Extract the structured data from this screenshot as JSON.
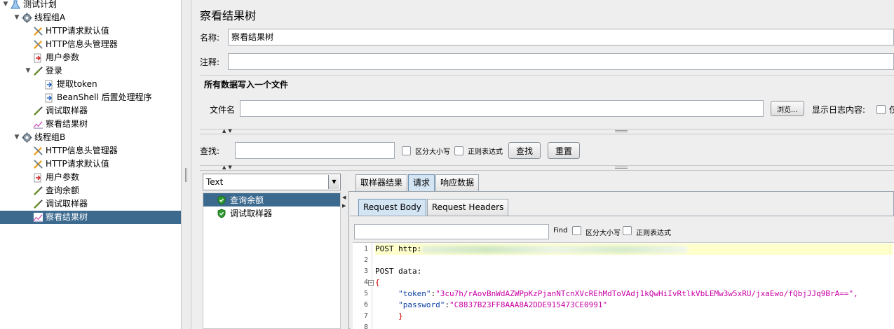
{
  "tree": {
    "items": [
      {
        "label": "测试计划",
        "icon": "test-plan-icon",
        "twist": "▼",
        "level": 0
      },
      {
        "label": "线程组A",
        "icon": "gear-icon",
        "twist": "▼",
        "level": 1
      },
      {
        "label": "HTTP请求默认值",
        "icon": "wrench-icon",
        "twist": "",
        "level": 2
      },
      {
        "label": "HTTP信息头管理器",
        "icon": "wrench-icon",
        "twist": "",
        "level": 2
      },
      {
        "label": "用户参数",
        "icon": "preprocessor-icon",
        "twist": "",
        "level": 2
      },
      {
        "label": "登录",
        "icon": "pipette-icon",
        "twist": "▼",
        "level": 2
      },
      {
        "label": "提取token",
        "icon": "postprocessor-icon",
        "twist": "",
        "level": 3
      },
      {
        "label": "BeanShell 后置处理程序",
        "icon": "postprocessor-icon",
        "twist": "",
        "level": 3
      },
      {
        "label": "调试取样器",
        "icon": "pipette-icon",
        "twist": "",
        "level": 2
      },
      {
        "label": "察看结果树",
        "icon": "listener-icon",
        "twist": "",
        "level": 2
      },
      {
        "label": "线程组B",
        "icon": "gear-icon",
        "twist": "▼",
        "level": 1
      },
      {
        "label": "HTTP信息头管理器",
        "icon": "wrench-icon",
        "twist": "",
        "level": 2
      },
      {
        "label": "HTTP请求默认值",
        "icon": "wrench-icon",
        "twist": "",
        "level": 2
      },
      {
        "label": "用户参数",
        "icon": "preprocessor-icon",
        "twist": "",
        "level": 2
      },
      {
        "label": "查询余额",
        "icon": "pipette-icon",
        "twist": "",
        "level": 2
      },
      {
        "label": "调试取样器",
        "icon": "pipette-icon",
        "twist": "",
        "level": 2
      },
      {
        "label": "察看结果树",
        "icon": "listener-icon",
        "twist": "",
        "level": 2,
        "selected": true
      }
    ]
  },
  "panel": {
    "title": "察看结果树",
    "name_label": "名称:",
    "name_value": "察看结果树",
    "comment_label": "注释:",
    "comment_value": "",
    "file_group_title": "所有数据写入一个文件",
    "filename_label": "文件名",
    "filename_value": "",
    "browse_button": "浏览...",
    "log_display_label": "显示日志内容:",
    "log_display_option": "仅",
    "search_label": "查找:",
    "search_value": "",
    "case_sensitive": "区分大小写",
    "regex": "正则表达式",
    "find_button": "查找",
    "reset_button": "重置"
  },
  "results": {
    "renderer": "Text",
    "samples": [
      {
        "label": "查询余额",
        "selected": true
      },
      {
        "label": "调试取样器",
        "selected": false
      }
    ]
  },
  "detail": {
    "tabs": [
      "取样器结果",
      "请求",
      "响应数据"
    ],
    "active_tab": "请求",
    "subtabs": [
      "Request Body",
      "Request Headers"
    ],
    "active_subtab": "Request Body",
    "find_label": "Find",
    "case_sensitive": "区分大小写",
    "regex": "正则表达式",
    "code_lines": [
      {
        "num": "1",
        "text": "POST http:",
        "highlight": true,
        "blurred": true
      },
      {
        "num": "2",
        "text": ""
      },
      {
        "num": "3",
        "text": "POST data:"
      },
      {
        "num": "4",
        "text": "{",
        "fold": true
      },
      {
        "num": "5",
        "key": "\"token\"",
        "value": "\"3cu7h/rAovBnWdAZWPpKzPjanNTcnXVcREhMdToVAdj1kQwHiIvRtlkVbLEMw3w5xRU/jxaEwo/fQbjJJq9BrA==\","
      },
      {
        "num": "6",
        "key": "\"password\"",
        "value": "\"C8837B23FF8AAA8A2DDE915473CE0991\""
      },
      {
        "num": "7",
        "text": "}"
      },
      {
        "num": "8",
        "text": ""
      }
    ]
  },
  "colors": {
    "selection": "#3c6a8f",
    "active_tab": "#d3e4f3",
    "string": "#c800a4",
    "key": "#0a3fa0",
    "line_highlight": "#ffffcc"
  }
}
